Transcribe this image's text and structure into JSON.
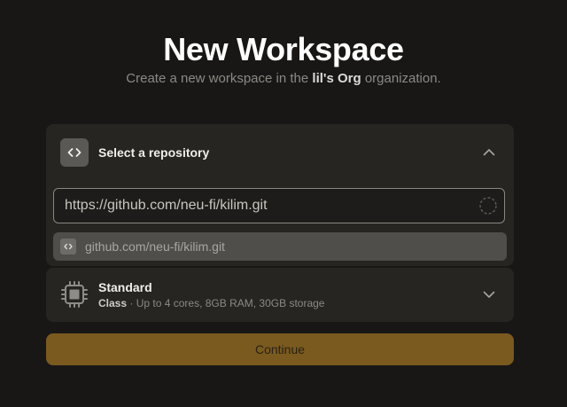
{
  "header": {
    "title": "New Workspace",
    "subtitle_prefix": "Create a new workspace in the ",
    "org_name": "lil's Org",
    "subtitle_suffix": " organization."
  },
  "repository": {
    "label": "Select a repository",
    "input_value": "https://github.com/neu-fi/kilim.git",
    "suggestion": "github.com/neu-fi/kilim.git"
  },
  "workspace_class": {
    "name": "Standard",
    "kind": "Class",
    "separator": " · ",
    "description": "Up to 4 cores, 8GB RAM, 30GB storage"
  },
  "actions": {
    "continue_label": "Continue"
  },
  "colors": {
    "accent": "#7a5a1e",
    "background": "#181716",
    "card": "#262522"
  }
}
